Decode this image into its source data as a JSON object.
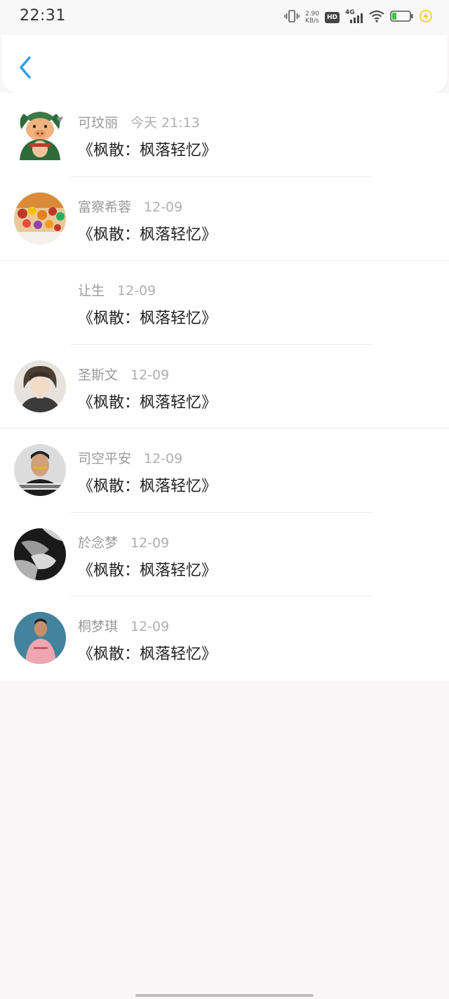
{
  "status_bar": {
    "time": "22:31",
    "net_speed_value": "2.90",
    "net_speed_unit": "KB/s",
    "hd_label": "HD",
    "network_label": "4G",
    "icons": [
      "vibrate-icon",
      "hd-icon",
      "signal-4g-icon",
      "wifi-icon",
      "battery-icon",
      "charging-bolt-icon"
    ],
    "battery_fill_color": "#3fc43f",
    "bolt_color": "#f5c518"
  },
  "header": {
    "back_icon": "chevron-left-icon",
    "accent": "#2aa1e8"
  },
  "comments": [
    {
      "name": "可玟丽",
      "time": "今天 21:13",
      "content": "《枫散：枫落轻忆》",
      "avatar": "pig-cartoon-avatar"
    },
    {
      "name": "富察希蓉",
      "time": "12-09",
      "content": "《枫散：枫落轻忆》",
      "avatar": "food-photo-avatar"
    },
    {
      "name": "让生",
      "time": "12-09",
      "content": "《枫散：枫落轻忆》",
      "avatar": "empty-avatar"
    },
    {
      "name": "圣斯文",
      "time": "12-09",
      "content": "《枫散：枫落轻忆》",
      "avatar": "anime-boy-avatar"
    },
    {
      "name": "司空平安",
      "time": "12-09",
      "content": "《枫散：枫落轻忆》",
      "avatar": "person-photo-avatar"
    },
    {
      "name": "於念梦",
      "time": "12-09",
      "content": "《枫散：枫落轻忆》",
      "avatar": "bw-portrait-avatar"
    },
    {
      "name": "桐梦琪",
      "time": "12-09",
      "content": "《枫散：枫落轻忆》",
      "avatar": "pink-shirt-person-avatar"
    }
  ]
}
